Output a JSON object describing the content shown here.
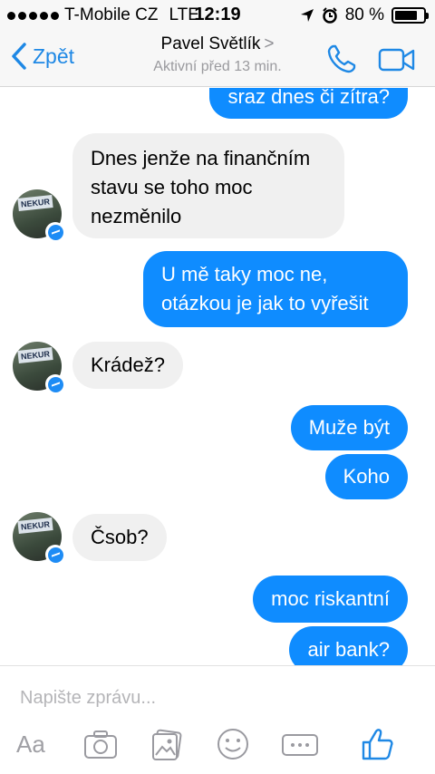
{
  "status": {
    "carrier": "T-Mobile CZ",
    "network": "LTE",
    "time": "12:19",
    "battery": "80 %",
    "battery_level": 0.8
  },
  "header": {
    "back_label": "Zpět",
    "contact_name": "Pavel Světlík",
    "chevron": ">",
    "activity": "Aktivní před 13 min."
  },
  "messages": [
    {
      "dir": "out",
      "text": "sraz dnes či zítra?"
    },
    {
      "dir": "in",
      "text": "Dnes jenže na finančním stavu se toho moc nezměnilo"
    },
    {
      "dir": "out",
      "text": "U mě taky moc ne, otázkou je jak to vyřešit"
    },
    {
      "dir": "in",
      "text": "Krádež?"
    },
    {
      "dir": "out",
      "text": "Muže být"
    },
    {
      "dir": "out",
      "text": "Koho"
    },
    {
      "dir": "in",
      "text": "Čsob?"
    },
    {
      "dir": "out",
      "text": "moc riskantní"
    },
    {
      "dir": "out",
      "text": "air bank?"
    }
  ],
  "avatar_sign": "NEKUR",
  "composer": {
    "placeholder": "Napište zprávu...",
    "aa_label": "Aa"
  },
  "colors": {
    "accent": "#1e88e5",
    "outgoing_bubble": "#0f8cff",
    "incoming_bubble": "#f0f0f0"
  },
  "icons": [
    "back-chevron-icon",
    "phone-icon",
    "video-camera-icon",
    "camera-icon",
    "photo-gallery-icon",
    "emoji-icon",
    "more-icon",
    "thumbs-up-icon",
    "messenger-badge-icon"
  ]
}
